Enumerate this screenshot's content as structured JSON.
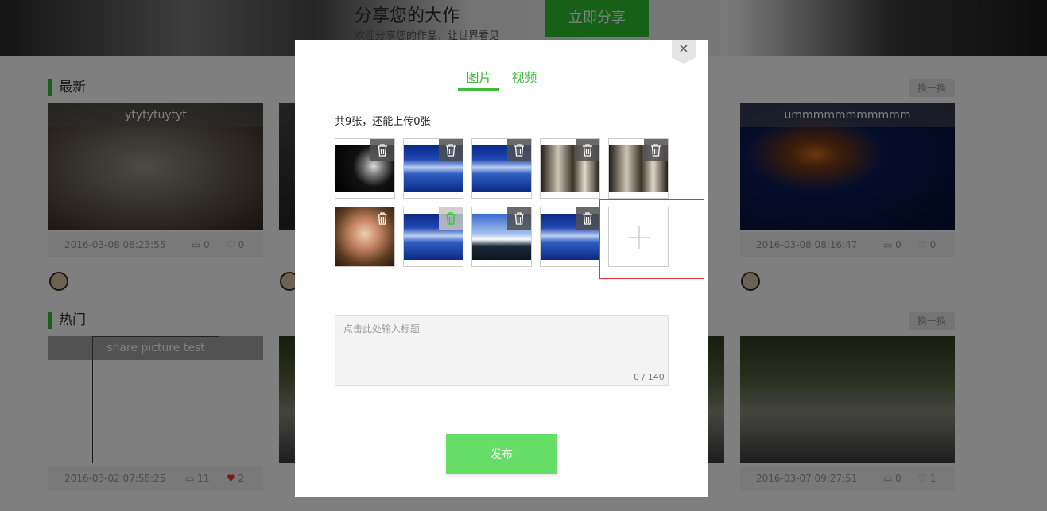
{
  "hero": {
    "title": "分享您的大作",
    "subtitle": "欢迎分享您的作品，让世界看见",
    "share_button": "立即分享"
  },
  "sections": {
    "latest": {
      "title": "最新",
      "swap_label": "换一换"
    },
    "hot": {
      "title": "热门",
      "swap_label": "换一换"
    }
  },
  "cards": {
    "latest_1": {
      "caption": "ytytytuytyt",
      "date": "2016-03-08 08:23:55",
      "comments": "0",
      "likes": "0"
    },
    "latest_4": {
      "caption": "ummmmmmmmmmm",
      "date": "2016-03-08 08:16:47",
      "comments": "0",
      "likes": "0"
    },
    "hot_1": {
      "caption": "share picture test",
      "date": "2016-03-02 07:58:25",
      "comments": "11",
      "likes": "2"
    },
    "hot_4": {
      "caption": "",
      "date": "2016-03-07 09:27:51",
      "comments": "0",
      "likes": "1"
    }
  },
  "modal": {
    "close_label": "×",
    "tabs": [
      {
        "label": "图片",
        "active": true
      },
      {
        "label": "视频",
        "active": false
      }
    ],
    "count_text": "共9张，还能上传0张",
    "title_placeholder": "点击此处输入标题",
    "char_count": "0 / 140",
    "publish_label": "发布"
  },
  "colors": {
    "accent": "#3dbb3d",
    "publish": "#66dd66",
    "add_outline": "#e03333"
  }
}
